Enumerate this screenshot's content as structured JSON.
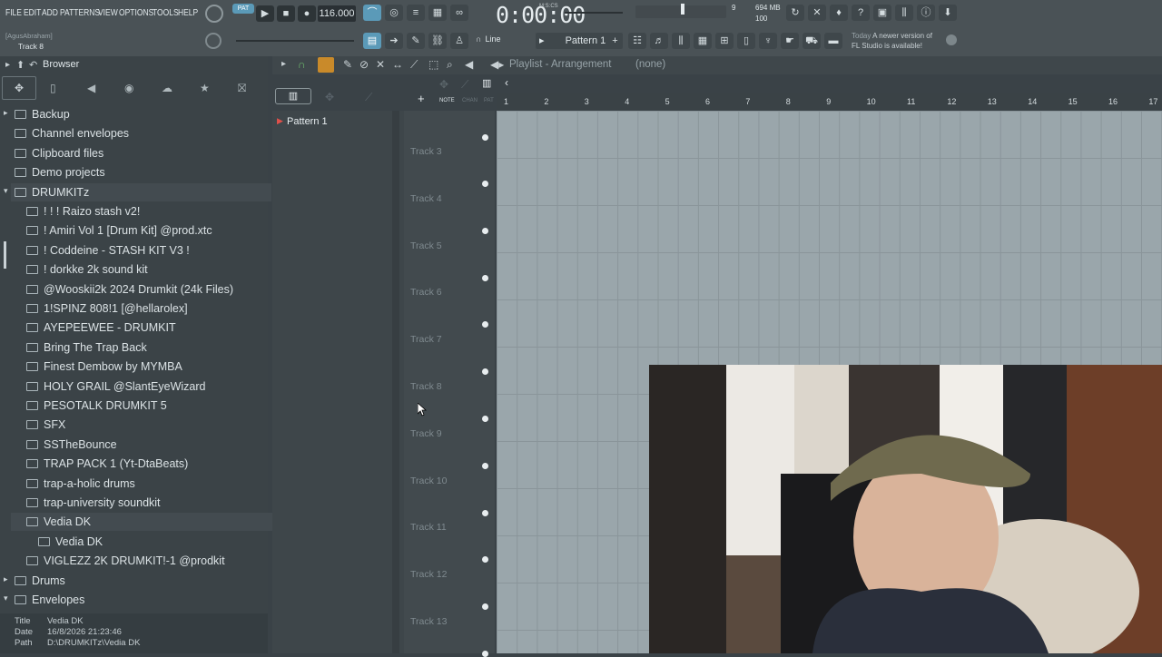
{
  "menu": [
    "FILE",
    "EDIT",
    "ADD",
    "PATTERNS",
    "VIEW",
    "OPTIONS",
    "TOOLS",
    "HELP"
  ],
  "transport": {
    "pat_label": "PAT",
    "tempo": "116.000",
    "time": "0:00:00",
    "time_unit": "M:S:CS",
    "bar_value": "9"
  },
  "memory": {
    "mb": "694 MB",
    "cpu": "100"
  },
  "hint": {
    "user": "[AgusAbraham]",
    "track": "Track 8"
  },
  "news": {
    "title": "Today",
    "text": "A newer version of",
    "text2": "FL Studio is available!"
  },
  "snap": "Line",
  "pattern_selector": "Pattern 1",
  "browser": {
    "title": "Browser",
    "items": [
      {
        "label": "Backup",
        "level": 0
      },
      {
        "label": "Channel envelopes",
        "level": 0
      },
      {
        "label": "Clipboard files",
        "level": 0
      },
      {
        "label": "Demo projects",
        "level": 0
      },
      {
        "label": "DRUMKITz",
        "level": 0
      },
      {
        "label": "! ! ! Raizo stash v2!",
        "level": 1
      },
      {
        "label": "! Amiri Vol 1 [Drum Kit] @prod.xtc",
        "level": 1
      },
      {
        "label": "! Coddeine - STASH KIT V3 !",
        "level": 1
      },
      {
        "label": "! dorkke 2k sound kit",
        "level": 1
      },
      {
        "label": "@Wooskii2k 2024 Drumkit (24k Files)",
        "level": 1
      },
      {
        "label": "1!SPINZ 808!1 [@hellarolex]",
        "level": 1
      },
      {
        "label": "AYEPEEWEE - DRUMKIT",
        "level": 1
      },
      {
        "label": "Bring The Trap Back",
        "level": 1
      },
      {
        "label": "Finest Dembow by MYMBA",
        "level": 1
      },
      {
        "label": "HOLY GRAIL @SlantEyeWizard",
        "level": 1
      },
      {
        "label": "PESOTALK DRUMKIT 5",
        "level": 1
      },
      {
        "label": "SFX",
        "level": 1
      },
      {
        "label": "SSTheBounce",
        "level": 1
      },
      {
        "label": "TRAP PACK 1 (Yt-DtaBeats)",
        "level": 1
      },
      {
        "label": "trap-a-holic drums",
        "level": 1
      },
      {
        "label": "trap-university soundkit",
        "level": 1
      },
      {
        "label": "Vedia DK",
        "level": 1
      },
      {
        "label": "Vedia DK",
        "level": 2
      },
      {
        "label": "VIGLEZZ 2K DRUMKIT!-1 @prodkit",
        "level": 1
      },
      {
        "label": "Drums",
        "level": 0
      },
      {
        "label": "Envelopes",
        "level": 0
      }
    ],
    "info": {
      "title_key": "Title",
      "title_val": "Vedia DK",
      "date_key": "Date",
      "date_val": "16/8/2026 21:23:46",
      "path_key": "Path",
      "path_val": "D:\\DRUMKITz\\Vedia DK"
    }
  },
  "playlist": {
    "title": "Playlist - Arrangement",
    "arrangement": "(none)",
    "patterns": [
      "Pattern 1"
    ],
    "ruler": [
      "1",
      "2",
      "3",
      "4",
      "5",
      "6",
      "7",
      "8",
      "9",
      "10",
      "11",
      "12",
      "13",
      "14",
      "15",
      "16",
      "17"
    ],
    "tracks": [
      "Track 3",
      "Track 4",
      "Track 5",
      "Track 6",
      "Track 7",
      "Track 8",
      "Track 9",
      "Track 10",
      "Track 11",
      "Track 12",
      "Track 13"
    ],
    "mini_labels": [
      "NOTE",
      "CHAN",
      "PAT"
    ]
  }
}
